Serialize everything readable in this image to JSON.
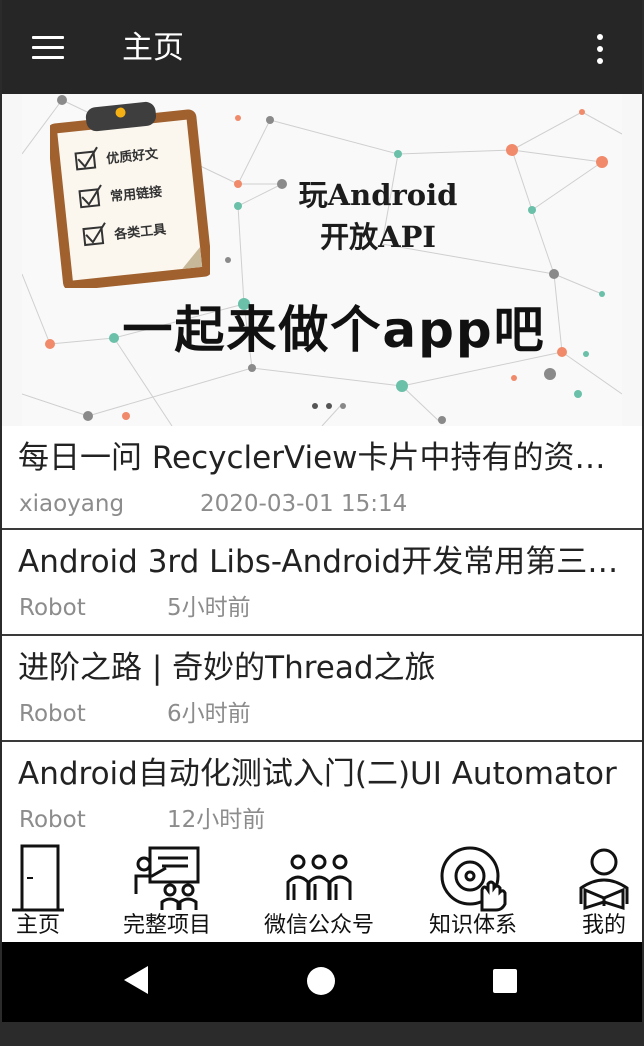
{
  "app_bar": {
    "title": "主页"
  },
  "banner": {
    "checklist": [
      "优质好文",
      "常用链接",
      "各类工具"
    ],
    "title_line1": "玩Android",
    "title_line2": "开放API",
    "slogan": "一起来做个app吧"
  },
  "articles": [
    {
      "title": "每日一问 RecyclerView卡片中持有的资源...",
      "author": "xiaoyang",
      "time": "2020-03-01 15:14"
    },
    {
      "title": "Android 3rd Libs-Android开发常用第三方...",
      "author": "Robot",
      "time": "5小时前"
    },
    {
      "title": "进阶之路 | 奇妙的Thread之旅",
      "author": "Robot",
      "time": "6小时前"
    },
    {
      "title": "Android自动化测试入门(二)UI Automator",
      "author": "Robot",
      "time": "12小时前"
    }
  ],
  "bottom_nav": [
    {
      "label": "主页",
      "icon": "door-icon"
    },
    {
      "label": "完整项目",
      "icon": "presentation-icon"
    },
    {
      "label": "微信公众号",
      "icon": "people-group-icon"
    },
    {
      "label": "知识体系",
      "icon": "disc-hand-icon"
    },
    {
      "label": "我的",
      "icon": "person-reading-icon"
    }
  ],
  "system_nav": {
    "back": "back-icon",
    "home": "home-icon",
    "recents": "recents-icon"
  },
  "colors": {
    "app_bar": "#262626",
    "divider": "#3a3a3a",
    "meta_text": "#8c8c8c",
    "clipboard": "#a0612e"
  }
}
